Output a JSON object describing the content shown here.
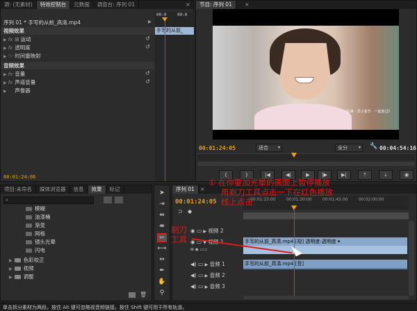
{
  "effect_controls_panel": {
    "tabs": [
      "源: (无素材)",
      "特效控制台",
      "元数据",
      "调音台: 序列 01"
    ],
    "active_tab": "特效控制台",
    "clip_label": "序列 01 * 手写的从前_高清.mp4",
    "time_start": "00:0",
    "time_end": "00:0",
    "clip_tag": "手写的从前_",
    "video_effects_header": "视频效果",
    "video_effects": [
      "运动",
      "透明度",
      "时间重映射"
    ],
    "audio_effects_header": "音频效果",
    "audio_effects": [
      "音量",
      "声道音量",
      "声像器"
    ],
    "current_time": "00:01:24:06"
  },
  "program_monitor": {
    "tab_label": "节目: 序列 01",
    "video_caption": "《后来 · 早小金节 · 一起走过》",
    "current_time": "00:01:24:05",
    "fit_option": "适合",
    "resolution_option": "全分",
    "duration": "00:04:54:16"
  },
  "project_panel": {
    "tabs": [
      "项目:未命名",
      "媒体浏览器",
      "信息",
      "效果",
      "标记"
    ],
    "active_tab": "效果",
    "search_placeholder": "",
    "items": [
      "模糊",
      "油漆桶",
      "渐变",
      "网格",
      "镜头光晕",
      "闪电",
      "色彩校正",
      "视频",
      "调整"
    ],
    "status": "单击拆分素材为两段。按住 Alt 键可忽略视音频链接。按住 Shift 键可用于所有轨道。"
  },
  "timeline": {
    "tab_label": "序列 01",
    "current_time": "00:01:24:05",
    "ruler_labels": [
      "00:01:15:00",
      "00:01:30:00",
      "00:01:45:00",
      "00:02:00:00"
    ],
    "tracks": [
      "视频 2",
      "视频 1",
      "音频 1",
      "音频 2",
      "音频 3"
    ],
    "video_clip": "手写的从前_高清.mp4 [视]  透明度:透明度 ▾",
    "audio_clip": "手写的从前_高清.mp4 [音]"
  },
  "annotations": {
    "step_text_line1": "① 在你要加光晕的画面上暂停播放",
    "step_text_line2": "用剃刀工具点击一下在红色播放",
    "step_text_line3": "线上点击",
    "tool_label_line1": "剃刀",
    "tool_label_line2": "工具"
  },
  "colors": {
    "accent_timecode": "#e8a21a",
    "annotation_red": "#e01818",
    "video_clip": "#8aa6c8",
    "audio_clip": "#7fa0c4",
    "playhead": "#d23a3a"
  }
}
